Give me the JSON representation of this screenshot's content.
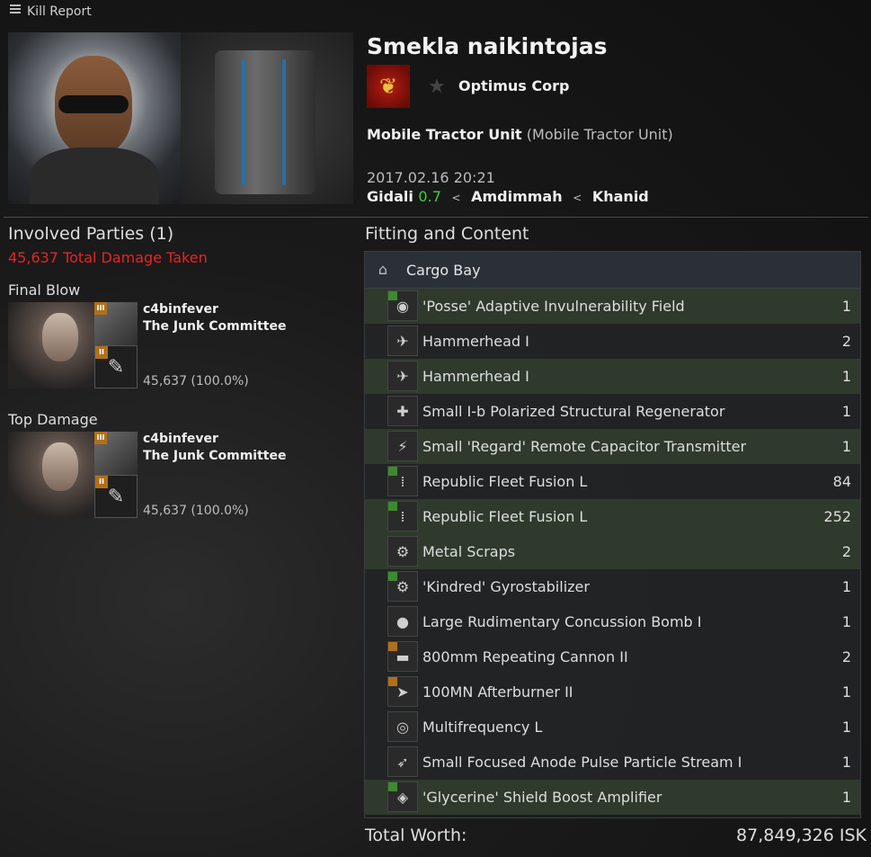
{
  "window": {
    "title": "Kill Report"
  },
  "victim": {
    "name": "Smekla naikintojas",
    "corporation": "Optimus Corp",
    "ship": "Mobile Tractor Unit",
    "ship_type": "(Mobile Tractor Unit)",
    "datetime": "2017.02.16 20:21",
    "system": "Gidali",
    "security": "0.7",
    "constellation": "Amdimmah",
    "region": "Khanid",
    "separator": "<"
  },
  "involved": {
    "heading": "Involved Parties (1)",
    "total_damage": "45,637 Total Damage Taken",
    "final_blow": {
      "label": "Final Blow",
      "pilot": "c4binfever",
      "corp": "The Junk Committee",
      "damage": "45,637 (100.0%)",
      "ship_tech": "III",
      "weapon_tech": "II"
    },
    "top_damage": {
      "label": "Top Damage",
      "pilot": "c4binfever",
      "corp": "The Junk Committee",
      "damage": "45,637 (100.0%)",
      "ship_tech": "III",
      "weapon_tech": "II"
    }
  },
  "fitting": {
    "heading": "Fitting and Content",
    "section": "Cargo Bay",
    "items": [
      {
        "name": "'Posse' Adaptive Invulnerability Field",
        "qty": "1",
        "status": "dropped",
        "meta": "green",
        "icon": "shield-module-icon"
      },
      {
        "name": "Hammerhead I",
        "qty": "2",
        "status": "destroyed",
        "meta": "",
        "icon": "drone-icon"
      },
      {
        "name": "Hammerhead I",
        "qty": "1",
        "status": "dropped",
        "meta": "",
        "icon": "drone-icon"
      },
      {
        "name": "Small I-b Polarized Structural Regenerator",
        "qty": "1",
        "status": "destroyed",
        "meta": "",
        "icon": "repair-module-icon"
      },
      {
        "name": "Small 'Regard' Remote Capacitor Transmitter",
        "qty": "1",
        "status": "dropped",
        "meta": "",
        "icon": "capacitor-transmitter-icon"
      },
      {
        "name": "Republic Fleet Fusion L",
        "qty": "84",
        "status": "destroyed",
        "meta": "green",
        "icon": "ammo-icon"
      },
      {
        "name": "Republic Fleet Fusion L",
        "qty": "252",
        "status": "dropped",
        "meta": "green",
        "icon": "ammo-icon"
      },
      {
        "name": "Metal Scraps",
        "qty": "2",
        "status": "dropped",
        "meta": "",
        "icon": "scrap-icon"
      },
      {
        "name": "'Kindred' Gyrostabilizer",
        "qty": "1",
        "status": "destroyed",
        "meta": "green",
        "icon": "gyrostabilizer-icon"
      },
      {
        "name": "Large Rudimentary Concussion Bomb I",
        "qty": "1",
        "status": "destroyed",
        "meta": "",
        "icon": "bomb-icon"
      },
      {
        "name": "800mm Repeating Cannon II",
        "qty": "2",
        "status": "destroyed",
        "meta": "orange",
        "icon": "cannon-icon"
      },
      {
        "name": "100MN Afterburner II",
        "qty": "1",
        "status": "destroyed",
        "meta": "orange",
        "icon": "afterburner-icon"
      },
      {
        "name": "Multifrequency L",
        "qty": "1",
        "status": "destroyed",
        "meta": "",
        "icon": "crystal-icon"
      },
      {
        "name": "Small Focused Anode Pulse Particle Stream I",
        "qty": "1",
        "status": "destroyed",
        "meta": "",
        "icon": "laser-icon"
      },
      {
        "name": "'Glycerine' Shield Boost Amplifier",
        "qty": "1",
        "status": "dropped",
        "meta": "green",
        "icon": "shield-amplifier-icon"
      }
    ]
  },
  "total": {
    "label": "Total Worth:",
    "value": "87,849,326 ISK"
  },
  "colors": {
    "dropped_row": "#2f3a2c",
    "destroyed_row": "#222325",
    "security_high": "#3bd33b",
    "damage_red": "#e82424"
  }
}
